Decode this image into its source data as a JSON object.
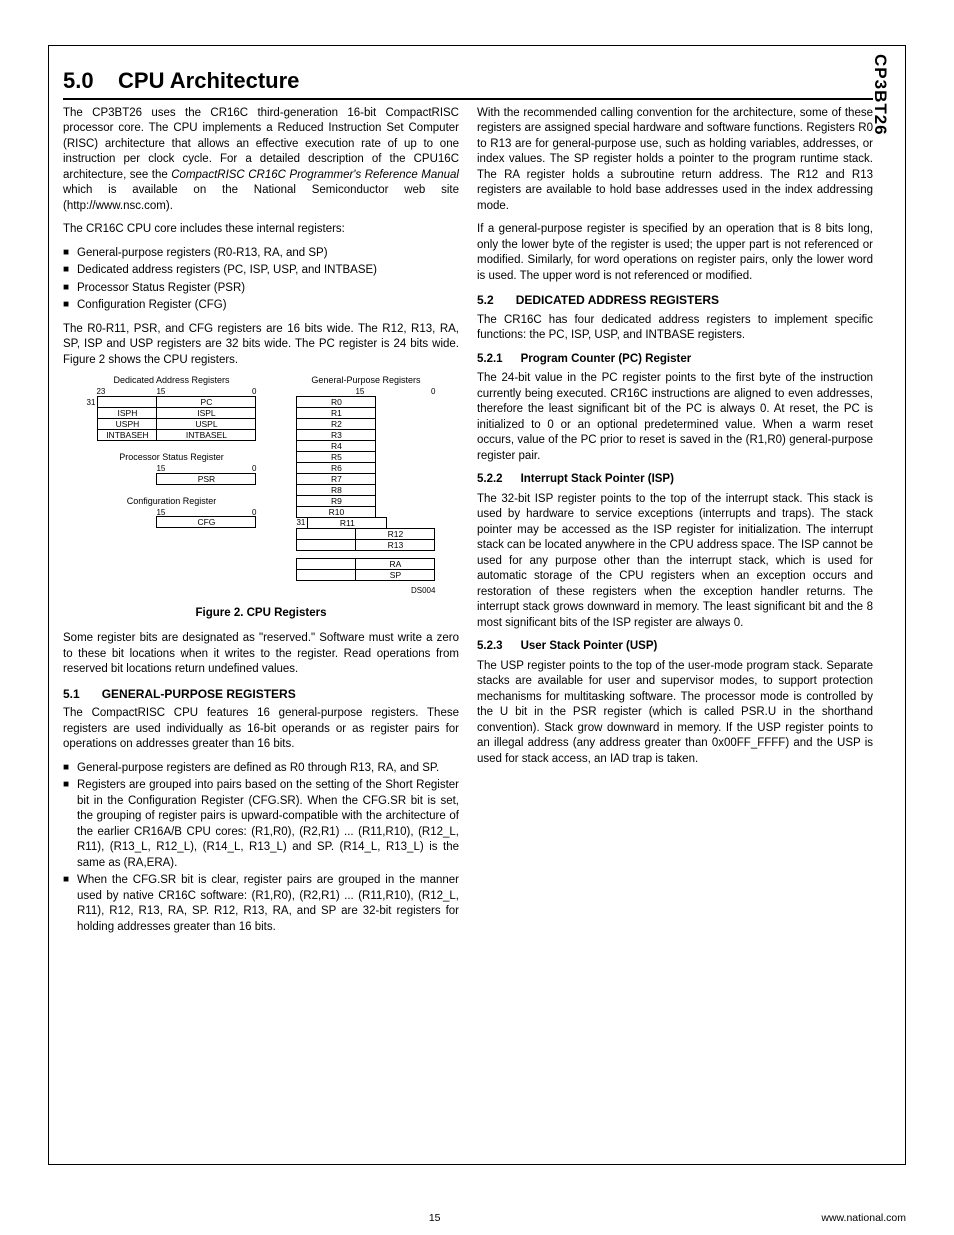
{
  "side_tab": "CP3BT26",
  "title_num": "5.0",
  "title_text": "CPU Architecture",
  "intro_p1a": "The CP3BT26 uses the CR16C third-generation 16-bit CompactRISC processor core. The CPU implements a Reduced Instruction Set Computer (RISC) architecture that allows an effective execution rate of up to one instruction per clock cycle. For a detailed description of the CPU16C architecture, see the ",
  "intro_p1_ital": "CompactRISC CR16C Programmer's Reference Manual",
  "intro_p1b": " which is available on the National Semiconductor web site (http://www.nsc.com).",
  "intro_p2": "The CR16C CPU core includes these internal registers:",
  "intro_list": [
    "General-purpose registers (R0-R13, RA, and SP)",
    "Dedicated address registers (PC, ISP, USP, and INTBASE)",
    "Processor Status Register (PSR)",
    "Configuration Register (CFG)"
  ],
  "intro_p3": "The R0-R11, PSR, and CFG registers are 16 bits wide. The R12, R13, RA, SP, ISP and USP registers are 32 bits wide. The PC register is 24 bits wide. Figure 2 shows the CPU registers.",
  "fig": {
    "dar_title": "Dedicated Address Registers",
    "gpr_title": "General-Purpose Registers",
    "psr_title": "Processor Status Register",
    "cfg_title": "Configuration Register",
    "dar_bits": [
      "23",
      "15",
      "0"
    ],
    "dar_bit_left": "31",
    "psr_bits": [
      "15",
      "0"
    ],
    "cfg_bits": [
      "15",
      "0"
    ],
    "gpr_bits": [
      "15",
      "0"
    ],
    "gpr_bit_left": "31",
    "dar_rows": [
      [
        "",
        "PC"
      ],
      [
        "ISPH",
        "ISPL"
      ],
      [
        "USPH",
        "USPL"
      ],
      [
        "INTBASEH",
        "INTBASEL"
      ]
    ],
    "psr_row": "PSR",
    "cfg_row": "CFG",
    "gpr_rows": [
      "R0",
      "R1",
      "R2",
      "R3",
      "R4",
      "R5",
      "R6",
      "R7",
      "R8",
      "R9",
      "R10",
      "R11",
      "R12",
      "R13"
    ],
    "gpr_extra": [
      "RA",
      "SP"
    ],
    "ds": "DS004",
    "caption": "Figure 2.   CPU Registers"
  },
  "p_reserved": "Some register bits are designated as \"reserved.\" Software must write a zero to these bit locations when it writes to the register. Read operations from reserved bit locations return undefined values.",
  "s51_num": "5.1",
  "s51_title": "GENERAL-PURPOSE REGISTERS",
  "s51_p1": "The CompactRISC CPU features 16 general-purpose registers. These registers are used individually as 16-bit operands or as register pairs for operations on addresses greater than 16 bits.",
  "s51_list": [
    "General-purpose registers are defined as R0 through R13, RA, and SP.",
    "Registers are grouped into pairs based on the setting of the Short Register bit in the Configuration Register (CFG.SR). When the CFG.SR bit is set, the grouping of register pairs is upward-compatible with the architecture of the earlier CR16A/B CPU cores: (R1,R0), (R2,R1) ... (R11,R10), (R12_L, R11), (R13_L, R12_L), (R14_L, R13_L) and SP. (R14_L, R13_L) is the same as (RA,ERA).",
    "When the CFG.SR bit is clear, register pairs are grouped in the manner used by native CR16C software: (R1,R0), (R2,R1) ... (R11,R10), (R12_L, R11), R12, R13, RA, SP. R12, R13, RA, and SP are 32-bit registers for holding addresses greater than 16 bits."
  ],
  "s51_p3": "With the recommended calling convention for the architecture, some of these registers are assigned special hardware and software functions. Registers R0 to R13 are for general-purpose use, such as holding variables, addresses, or index values. The SP register holds a pointer to the program runtime stack. The RA register holds a subroutine return address. The R12 and R13 registers are available to hold base addresses used in the index addressing mode.",
  "s51_p4": "If a general-purpose register is specified by an operation that is 8 bits long, only the lower byte of the register is used; the upper part is not referenced or modified. Similarly, for word operations on register pairs, only the lower word is used. The upper word is not referenced or modified.",
  "s52_num": "5.2",
  "s52_title": "DEDICATED ADDRESS REGISTERS",
  "s52_p1": "The CR16C has four dedicated address registers to implement specific functions: the PC, ISP, USP, and INTBASE registers.",
  "s521_num": "5.2.1",
  "s521_title": "Program Counter (PC) Register",
  "s521_p": "The 24-bit value in the PC register points to the first byte of the instruction currently being executed. CR16C instructions are aligned to even addresses, therefore the least significant bit of the PC is always 0. At reset, the PC is initialized to 0 or an optional predetermined value. When a warm reset occurs, value of the PC prior to reset is saved in the (R1,R0) general-purpose register pair.",
  "s522_num": "5.2.2",
  "s522_title": "Interrupt Stack Pointer (ISP)",
  "s522_p": "The 32-bit ISP register points to the top of the interrupt stack. This stack is used by hardware to service exceptions (interrupts and traps). The stack pointer may be accessed as the ISP register for initialization. The interrupt stack can be located anywhere in the CPU address space. The ISP cannot be used for any purpose other than the interrupt stack, which is used for automatic storage of the CPU registers when an exception occurs and restoration of these registers when the exception handler returns. The interrupt stack grows downward in memory. The least significant bit and the 8 most significant bits of the ISP register are always 0.",
  "s523_num": "5.2.3",
  "s523_title": "User Stack Pointer (USP)",
  "s523_p": "The USP register points to the top of the user-mode program stack. Separate stacks are available for user and supervisor modes, to support protection mechanisms for multitasking software. The processor mode is controlled by the U bit in the PSR register (which is called PSR.U in the shorthand convention). Stack grow downward in memory. If the USP register points to an illegal address (any address greater than 0x00FF_FFFF) and the USP is used for stack access, an IAD trap is taken.",
  "footer_page": "15",
  "footer_url": "www.national.com"
}
